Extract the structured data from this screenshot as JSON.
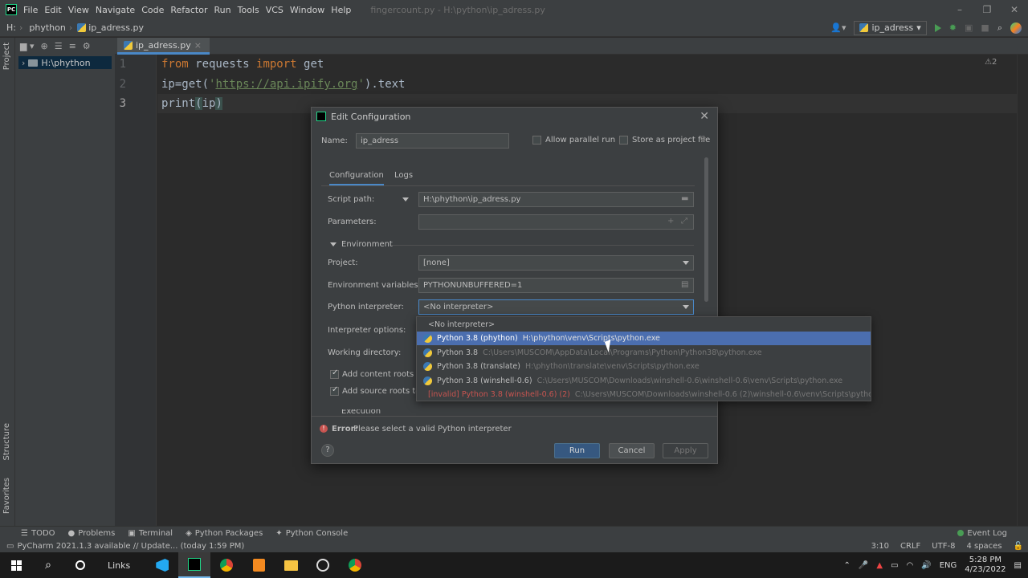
{
  "menubar": {
    "app_logo": "PC",
    "items": [
      "File",
      "Edit",
      "View",
      "Navigate",
      "Code",
      "Refactor",
      "Run",
      "Tools",
      "VCS",
      "Window",
      "Help"
    ],
    "window_title": "fingercount.py - H:\\python\\ip_adress.py"
  },
  "navbar": {
    "drive": "H:",
    "folder": "phython",
    "file": "ip_adress.py",
    "run_config": "ip_adress"
  },
  "left_stripe": {
    "project": "Project",
    "structure": "Structure",
    "favorites": "Favorites"
  },
  "project_panel": {
    "root": "H:\\phython"
  },
  "editor": {
    "tab": "ip_adress.py",
    "line_numbers": [
      "1",
      "2",
      "3"
    ],
    "line1": {
      "kw1": "from",
      "mod": " requests ",
      "kw2": "import",
      "name": " get"
    },
    "line2": {
      "pre": "ip",
      "op": "=",
      "call": "get(",
      "q1": "'",
      "url": "https://api.ipify.org",
      "q2": "'",
      "post": ").text"
    },
    "line3": {
      "fn": "print",
      "lp": "(",
      "arg": "ip",
      "rp": ")"
    },
    "warnings": "⚠2"
  },
  "dialog": {
    "title": "Edit Configuration",
    "name_label": "Name:",
    "name_value": "ip_adress",
    "allow_parallel_run": "Allow parallel run",
    "store_as_project_file": "Store as project file",
    "tabs": [
      "Configuration",
      "Logs"
    ],
    "script_path_label": "Script path:",
    "script_path_value": "H:\\phython\\ip_adress.py",
    "parameters_label": "Parameters:",
    "environment_section": "Environment",
    "project_label": "Project:",
    "project_value": "[none]",
    "env_vars_label": "Environment variables:",
    "env_vars_value": "PYTHONUNBUFFERED=1",
    "interpreter_label": "Python interpreter:",
    "interpreter_value": "<No interpreter>",
    "interpreter_options_label": "Interpreter options:",
    "working_dir_label": "Working directory:",
    "add_content_roots": "Add content roots to P",
    "add_source_roots": "Add source roots to P",
    "execution_section": "Execution",
    "error_prefix": "Error:",
    "error_message": "Please select a valid Python interpreter",
    "help": "?",
    "run_button": "Run",
    "cancel_button": "Cancel",
    "apply_button": "Apply"
  },
  "interpreter_dropdown": {
    "options": [
      {
        "label": "<No interpreter>",
        "path": ""
      },
      {
        "label": "Python 3.8 (phython)",
        "path": "H:\\phython\\venv\\Scripts\\python.exe"
      },
      {
        "label": "Python 3.8",
        "path": "C:\\Users\\MUSCOM\\AppData\\Local\\Programs\\Python\\Python38\\python.exe"
      },
      {
        "label": "Python 3.8 (translate)",
        "path": "H:\\phython\\translate\\venv\\Scripts\\python.exe"
      },
      {
        "label": "Python 3.8 (winshell-0.6)",
        "path": "C:\\Users\\MUSCOM\\Downloads\\winshell-0.6\\winshell-0.6\\venv\\Scripts\\python.exe"
      },
      {
        "label": "[invalid] Python 3.8 (winshell-0.6) (2)",
        "path": "C:\\Users\\MUSCOM\\Downloads\\winshell-0.6 (2)\\winshell-0.6\\venv\\Scripts\\python.exe"
      }
    ]
  },
  "bottom_tools": {
    "todo": "TODO",
    "problems": "Problems",
    "terminal": "Terminal",
    "python_packages": "Python Packages",
    "python_console": "Python Console",
    "event_log": "Event Log"
  },
  "statusbar": {
    "message": "PyCharm 2021.1.3 available // Update... (today 1:59 PM)",
    "position": "3:10",
    "line_sep": "CRLF",
    "encoding": "UTF-8",
    "indent": "4 spaces"
  },
  "taskbar": {
    "links": "Links",
    "lang": "ENG",
    "time": "5:28 PM",
    "date": "4/23/2022"
  },
  "colors": {
    "accent": "#4a88c7",
    "selection": "#4b6eaf",
    "error": "#c75450",
    "keyword": "#cc7832",
    "string": "#6a8759"
  }
}
